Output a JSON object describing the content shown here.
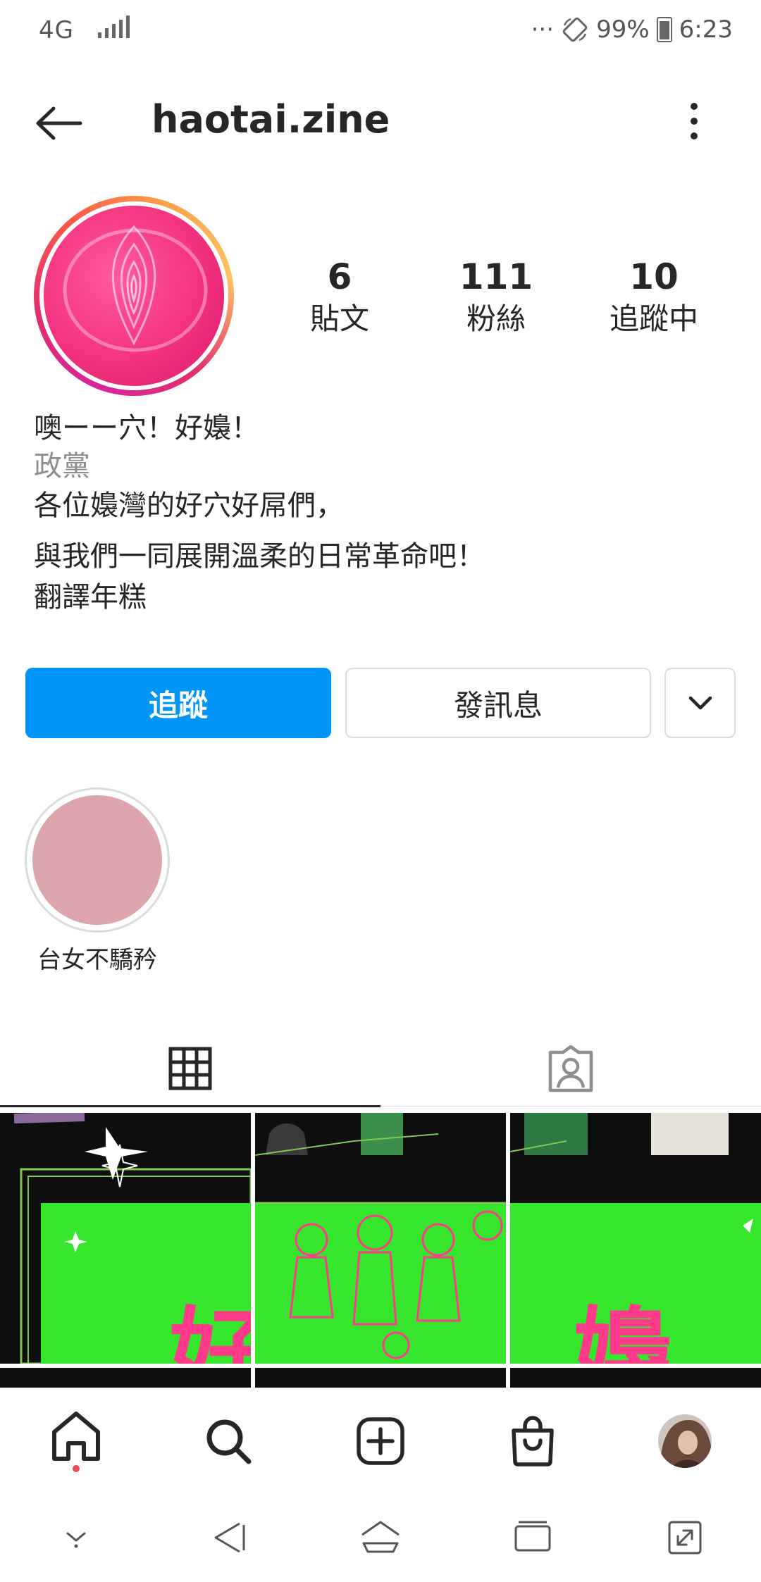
{
  "status_bar": {
    "network": "4G",
    "battery": "99%",
    "time": "6:23",
    "more": "···"
  },
  "header": {
    "username": "haotai.zine"
  },
  "stats": [
    {
      "count": "6",
      "label": "貼文"
    },
    {
      "count": "111",
      "label": "粉絲"
    },
    {
      "count": "10",
      "label": "追蹤中"
    }
  ],
  "bio": {
    "name": "噢ーー穴！好嬝！",
    "category": "政黨",
    "line1": "各位嬝灣的好穴好屌們，",
    "line2": "與我們一同展開溫柔的日常革命吧！",
    "line3": "翻譯年糕"
  },
  "buttons": {
    "follow": "追蹤",
    "message": "發訊息"
  },
  "highlight": {
    "label": "台女不驕矜"
  },
  "posts": [
    {
      "text": "好"
    },
    {
      "text": ""
    },
    {
      "text": "嬝"
    }
  ],
  "colors": {
    "accent": "#0095f6",
    "text": "#262626",
    "muted": "#8e8e8e",
    "post_green": "#35e62c",
    "post_pink": "#ff3a8a"
  },
  "icons": {
    "back": "arrow-left-icon",
    "more": "vertical-dots-icon",
    "grid": "grid-icon",
    "tagged": "tagged-person-icon",
    "home": "home-icon",
    "search": "search-icon",
    "add": "add-post-icon",
    "shop": "shop-bag-icon",
    "profile": "profile-avatar-icon"
  }
}
